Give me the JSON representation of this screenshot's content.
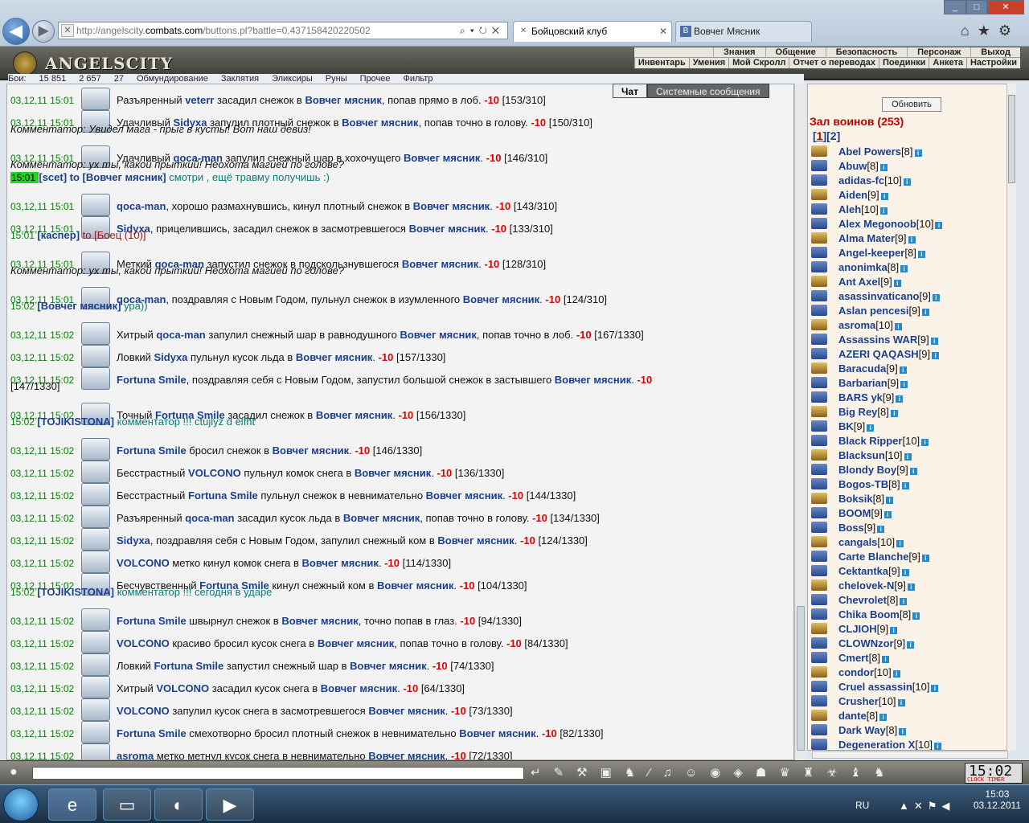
{
  "browser": {
    "url_prefix": "http://angelscity.",
    "url_host": "combats.com",
    "url_rest": "/buttons.pl?battle=0.437158420220502",
    "tabs": [
      {
        "label": "Бойцовский клуб",
        "active": true
      },
      {
        "label": "Вовчег Мясник",
        "active": false
      }
    ]
  },
  "game": {
    "logo": "ANGELSCITY",
    "menu_row1": [
      "Знания",
      "Общение",
      "Безопасность",
      "Персонаж",
      "Выход"
    ],
    "menu_row2": [
      "Инвентарь",
      "Умения",
      "Мой Скролл",
      "Отчет о переводах",
      "Поединки",
      "Анкета",
      "Настройки"
    ],
    "strip": [
      "Бои:",
      "15 851",
      "2 657",
      "27",
      "Обмундирование",
      "Заклятия",
      "Эликсиры",
      "Руны",
      "Прочее",
      "Фильтр"
    ]
  },
  "chat_tabs": [
    "Чат",
    "Системные сообщения"
  ],
  "chat": [
    {
      "ts": "03,12,11  15:01",
      "pre": "Разъяренный ",
      "a": "veterr",
      "mid": " засадил снежок в ",
      "b": "Вовчег мясник",
      "post": ", попав прямо в лоб. ",
      "dmg": "-10",
      "hp": " [153/310]"
    },
    {
      "ts": "03,12,11  15:01",
      "pre": "Удачливый ",
      "a": "Sidyxa",
      "mid": " запулил плотный снежок в ",
      "b": "Вовчег мясник",
      "post": ", попав точно в голову. ",
      "dmg": "-10",
      "hp": " [150/310]",
      "comment": "Комментатор: Увидел мага - прыг в кусты! Вот наш девиз!"
    },
    {
      "ts": "03,12,11  15:01",
      "pre": "Удачливый ",
      "a": "qoca-man",
      "mid": " запулил снежный шар в хохочущего ",
      "b": "Вовчег мясник",
      "post": ". ",
      "dmg": "-10",
      "hp": " [146/310]",
      "comment": "Комментатор: ух ты, какой прыткий! Неохота магией по голове?"
    },
    {
      "ts": "03,12,11  15:01",
      "pre": "",
      "a": "qoca-man",
      "mid": ", хорошо размахнувшись, кинул плотный снежок в ",
      "b": "Вовчег мясник",
      "post": ". ",
      "dmg": "-10",
      "hp": " [143/310]"
    },
    {
      "ts": "03,12,11  15:01",
      "pre": "",
      "a": "Sidyxa",
      "mid": ", прицелившись, засадил снежок в засмотревшегося ",
      "b": "Вовчег мясник",
      "post": ". ",
      "dmg": "-10",
      "hp": " [133/310]"
    },
    {
      "ts": "03,12,11  15:01",
      "pre": "Меткий ",
      "a": "qoca-man",
      "mid": " запустил снежок в подскользнувшегося ",
      "b": "Вовчег мясник",
      "post": ". ",
      "dmg": "-10",
      "hp": " [128/310]",
      "comment": "Комментатор: ух ты, какой прыткий! Неохота магией по голове?"
    },
    {
      "ts": "03,12,11  15:01",
      "pre": "",
      "a": "qoca-man",
      "mid": ", поздравляя с Новым Годом, пульнул снежок в изумленного ",
      "b": "Вовчег мясник",
      "post": ". ",
      "dmg": "-10",
      "hp": " [124/310]"
    },
    {
      "ts": "03,12,11  15:02",
      "pre": "Хитрый ",
      "a": "qoca-man",
      "mid": " запулил снежный шар в равнодушного ",
      "b": "Вовчег мясник",
      "post": ", попав точно в лоб. ",
      "dmg": "-10",
      "hp": " [167/1330]"
    },
    {
      "ts": "03,12,11  15:02",
      "pre": "Ловкий ",
      "a": "Sidyxa",
      "mid": " пульнул кусок льда в ",
      "b": "Вовчег мясник",
      "post": ". ",
      "dmg": "-10",
      "hp": " [157/1330]"
    },
    {
      "ts": "03,12,11  15:02",
      "pre": "",
      "a": "Fortuna Smile",
      "mid": ", поздравляя себя с Новым Годом, запустил большой снежок в застывшего ",
      "b": "Вовчег мясник",
      "post": ". ",
      "dmg": "-10",
      "hp": "",
      "wrap": "[147/1330]"
    },
    {
      "ts": "03,12,11  15:02",
      "pre": "Точный ",
      "a": "Fortuna Smile",
      "mid": " засадил снежок в ",
      "b": "Вовчег мясник",
      "post": ". ",
      "dmg": "-10",
      "hp": " [156/1330]"
    },
    {
      "ts": "03,12,11  15:02",
      "pre": "",
      "a": "Fortuna Smile",
      "mid": " бросил снежок в ",
      "b": "Вовчег мясник",
      "post": ". ",
      "dmg": "-10",
      "hp": " [146/1330]"
    },
    {
      "ts": "03,12,11  15:02",
      "pre": "Бесстрастный ",
      "a": "VOLCONO",
      "mid": " пульнул комок снега в ",
      "b": "Вовчег мясник",
      "post": ". ",
      "dmg": "-10",
      "hp": " [136/1330]"
    },
    {
      "ts": "03,12,11  15:02",
      "pre": "Бесстрастный ",
      "a": "Fortuna Smile",
      "mid": " пульнул снежок в невнимательно ",
      "b": "Вовчег мясник",
      "post": ". ",
      "dmg": "-10",
      "hp": " [144/1330]"
    },
    {
      "ts": "03,12,11  15:02",
      "pre": "Разъяренный ",
      "a": "qoca-man",
      "mid": " засадил кусок льда в ",
      "b": "Вовчег мясник",
      "post": ", попав точно в голову. ",
      "dmg": "-10",
      "hp": " [134/1330]"
    },
    {
      "ts": "03,12,11  15:02",
      "pre": "",
      "a": "Sidyxa",
      "mid": ", поздравляя себя с Новым Годом, запулил снежный ком в ",
      "b": "Вовчег мясник",
      "post": ". ",
      "dmg": "-10",
      "hp": " [124/1330]"
    },
    {
      "ts": "03,12,11  15:02",
      "pre": "",
      "a": "VOLCONO",
      "mid": " метко кинул комок снега в ",
      "b": "Вовчег мясник",
      "post": ". ",
      "dmg": "-10",
      "hp": " [114/1330]"
    },
    {
      "ts": "03,12,11  15:02",
      "pre": "Бесчувственный ",
      "a": "Fortuna Smile",
      "mid": " кинул снежный ком в ",
      "b": "Вовчег мясник",
      "post": ". ",
      "dmg": "-10",
      "hp": " [104/1330]"
    },
    {
      "ts": "03,12,11  15:02",
      "pre": "",
      "a": "Fortuna Smile",
      "mid": " швырнул снежок в ",
      "b": "Вовчег мясник",
      "post": ", точно попав в глаз. ",
      "dmg": "-10",
      "hp": " [94/1330]"
    },
    {
      "ts": "03,12,11  15:02",
      "pre": "",
      "a": "VOLCONO",
      "mid": " красиво бросил кусок снега в ",
      "b": "Вовчег мясник",
      "post": ", попав точно в голову. ",
      "dmg": "-10",
      "hp": " [84/1330]"
    },
    {
      "ts": "03,12,11  15:02",
      "pre": "Ловкий ",
      "a": "Fortuna Smile",
      "mid": " запустил снежный шар в ",
      "b": "Вовчег мясник",
      "post": ". ",
      "dmg": "-10",
      "hp": " [74/1330]"
    },
    {
      "ts": "03,12,11  15:02",
      "pre": "Хитрый ",
      "a": "VOLCONO",
      "mid": " засадил кусок снега в ",
      "b": "Вовчег мясник",
      "post": ". ",
      "dmg": "-10",
      "hp": " [64/1330]"
    },
    {
      "ts": "03,12,11  15:02",
      "pre": "",
      "a": "VOLCONO",
      "mid": " запулил кусок снега в засмотревшегося ",
      "b": "Вовчег мясник",
      "post": ". ",
      "dmg": "-10",
      "hp": " [73/1330]"
    },
    {
      "ts": "03,12,11  15:02",
      "pre": "",
      "a": "Fortuna Smile",
      "mid": " смехотворно бросил плотный снежок в невнимательно ",
      "b": "Вовчег мясник",
      "post": ". ",
      "dmg": "-10",
      "hp": " [82/1330]"
    },
    {
      "ts": "03,12,11  15:02",
      "pre": "",
      "a": "asroma",
      "mid": " метко метнул кусок снега в невнимательно ",
      "b": "Вовчег мясник",
      "post": ". ",
      "dmg": "-10",
      "hp": " [72/1330]"
    }
  ],
  "private_msgs": [
    {
      "after": 3,
      "time": "15:01",
      "from": "[scet]",
      "to": " to [Вовчег мясник]",
      "text": " смотри , ещё травму получишь :)"
    },
    {
      "after": 5,
      "time": "15:01",
      "from": "[каспер]",
      "to": " to [Боец (10)]",
      "text": ""
    },
    {
      "after": 7,
      "time": "15:02",
      "from": "[Вовчег мясник]",
      "to": "",
      "text": " ура))"
    },
    {
      "after": 11,
      "time": "15:02",
      "from": "[TOJIKISTONA]",
      "to": "",
      "text": " комментатор !!! ctujlyz d elfht"
    },
    {
      "after": 18,
      "time": "15:02",
      "from": "[TOJIKISTONA]",
      "to": "",
      "text": " комментатор !!! сегодня в ударе"
    }
  ],
  "side": {
    "refresh": "Обновить",
    "title": "Зал воинов (253)",
    "pages": [
      "1",
      "2"
    ],
    "players": [
      [
        "Abel Powers",
        "[8]"
      ],
      [
        "Abuw",
        "[8]"
      ],
      [
        "adidas-fc",
        "[10]"
      ],
      [
        "Aiden",
        "[9]"
      ],
      [
        "Aleh",
        "[10]"
      ],
      [
        "Alex Megonoob",
        "[10]"
      ],
      [
        "Alma Mater",
        "[9]"
      ],
      [
        "Angel-keeper",
        "[8]"
      ],
      [
        "anonimka",
        "[8]"
      ],
      [
        "Ant Axel",
        "[9]"
      ],
      [
        "asassinvaticano",
        "[9]"
      ],
      [
        "Aslan pencesi",
        "[9]"
      ],
      [
        "asroma",
        "[10]"
      ],
      [
        "Assassins WAR",
        "[9]"
      ],
      [
        "AZERI QAQASH",
        "[9]"
      ],
      [
        "Baracuda",
        "[9]"
      ],
      [
        "Barbarian",
        "[9]"
      ],
      [
        "BARS yk",
        "[9]"
      ],
      [
        "Big Rey",
        "[8]"
      ],
      [
        "BK",
        "[9]"
      ],
      [
        "Black Ripper",
        "[10]"
      ],
      [
        "Blacksun",
        "[10]"
      ],
      [
        "Blondy Boy",
        "[9]"
      ],
      [
        "Bogos-TB",
        "[8]"
      ],
      [
        "Boksik",
        "[8]"
      ],
      [
        "BOOM",
        "[9]"
      ],
      [
        "Boss",
        "[9]"
      ],
      [
        "cangals",
        "[10]"
      ],
      [
        "Carte Blanche",
        "[9]"
      ],
      [
        "Cektantka",
        "[9]"
      ],
      [
        "chelovek-N",
        "[9]"
      ],
      [
        "Chevrolet",
        "[8]"
      ],
      [
        "Chika Boom",
        "[8]"
      ],
      [
        "CLJIOH",
        "[9]"
      ],
      [
        "CLOWNzor",
        "[9]"
      ],
      [
        "Cmert",
        "[8]"
      ],
      [
        "condor",
        "[10]"
      ],
      [
        "Cruel assassin",
        "[10]"
      ],
      [
        "Crusher",
        "[10]"
      ],
      [
        "dante",
        "[8]"
      ],
      [
        "Dark Way",
        "[8]"
      ],
      [
        "Degeneration X",
        "[10]"
      ]
    ]
  },
  "clock": {
    "time": "15:02",
    "label": "CLOCK TIMER"
  },
  "taskbar": {
    "lang": "RU",
    "time": "15:03",
    "date": "03.12.2011"
  }
}
